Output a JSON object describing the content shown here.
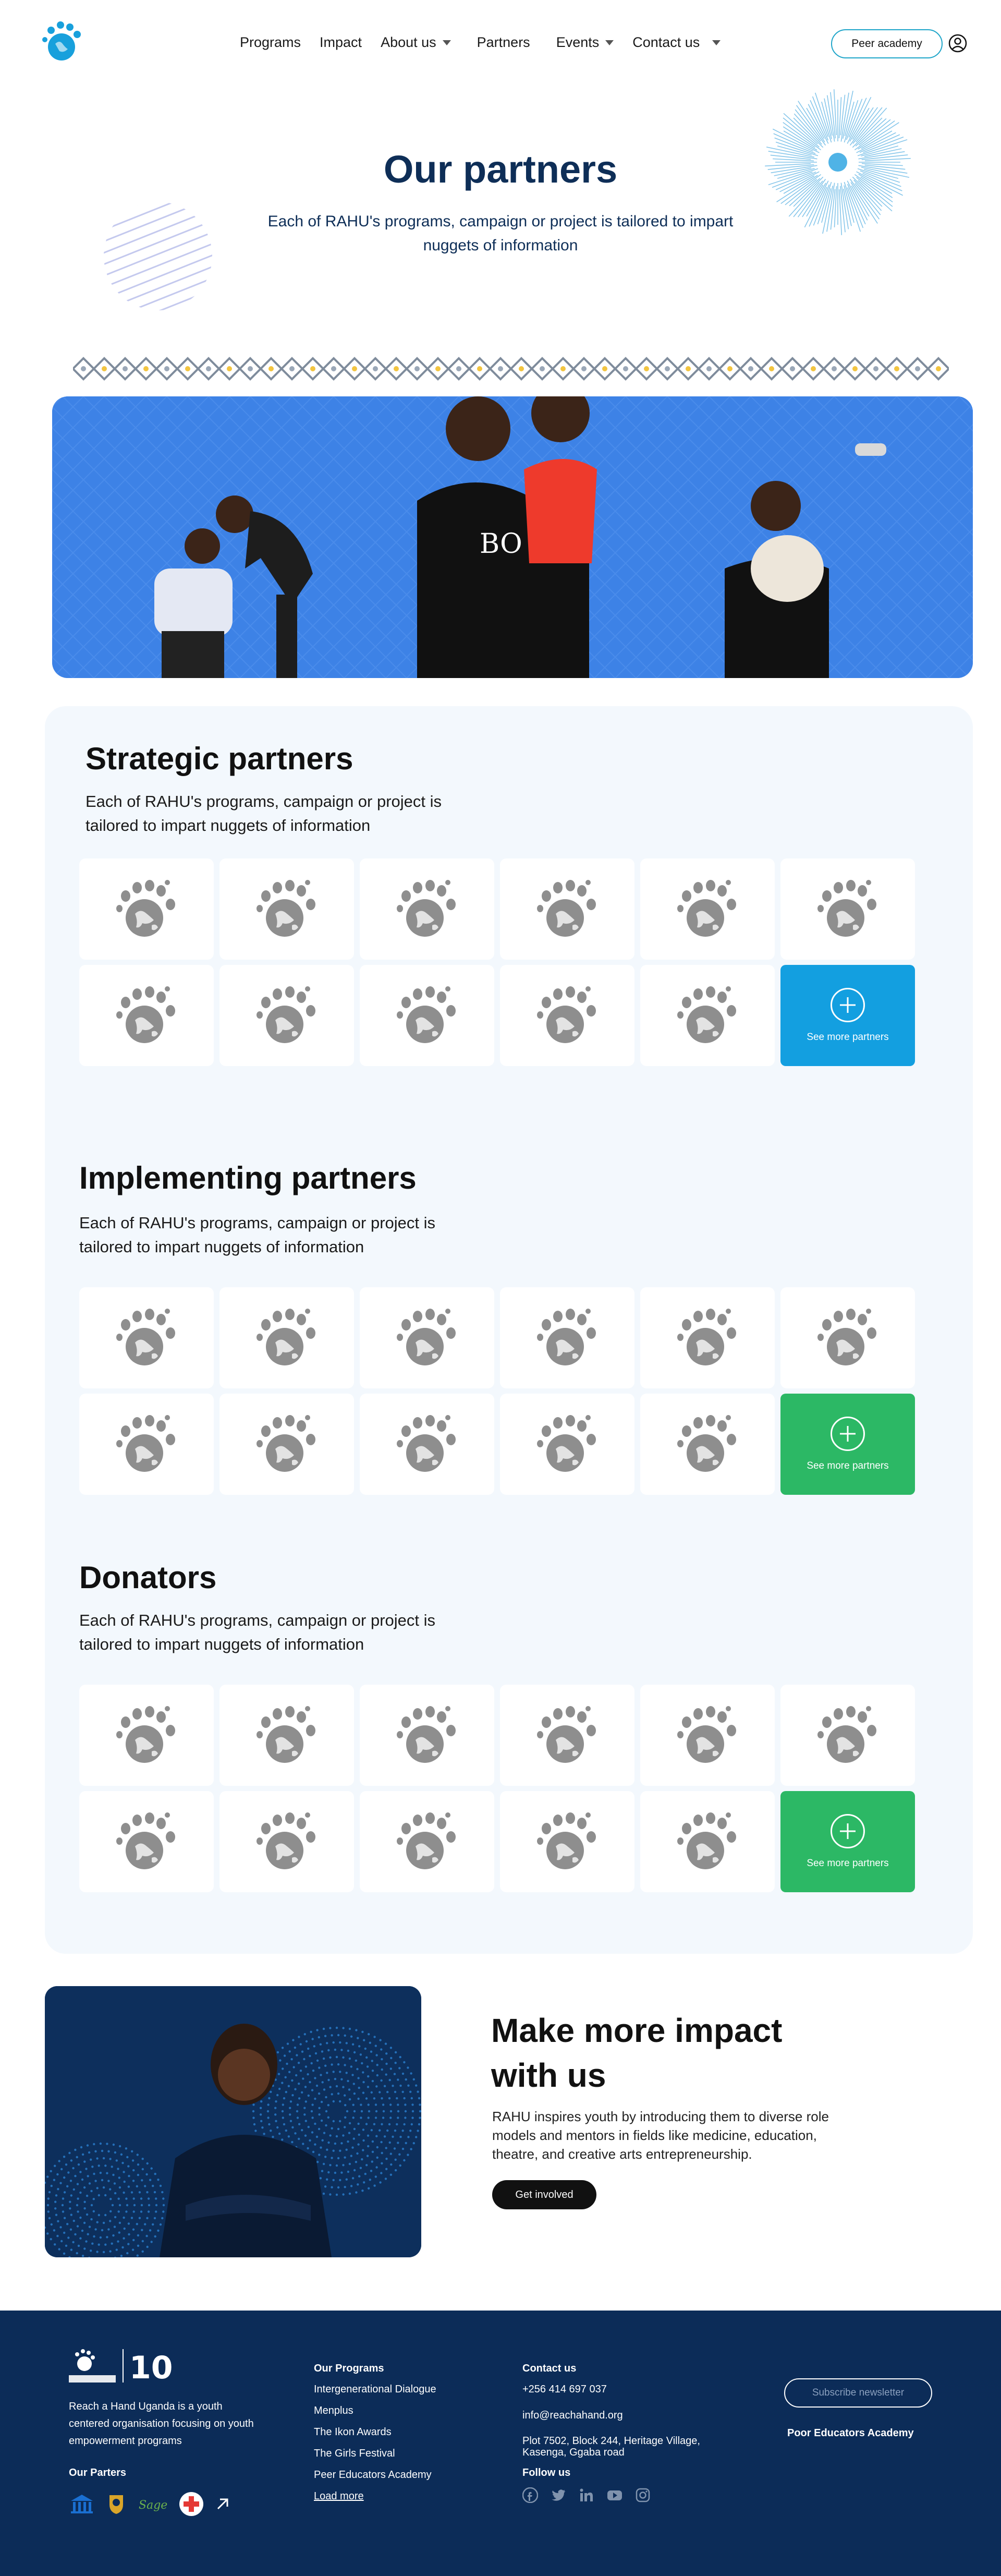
{
  "nav": {
    "items": [
      {
        "label": "Programs",
        "caret": false
      },
      {
        "label": "Impact",
        "caret": false
      },
      {
        "label": "About us",
        "caret": true
      },
      {
        "label": "Partners",
        "caret": false
      },
      {
        "label": "Events",
        "caret": true
      },
      {
        "label": "Contact us",
        "caret": true
      }
    ],
    "peer_academy": "Peer academy"
  },
  "hero": {
    "title": "Our partners",
    "subtitle": "Each of RAHU's programs, campaign or project is tailored to impart nuggets of information"
  },
  "sections": [
    {
      "title": "Strategic partners",
      "desc": "Each of RAHU's programs, campaign or project is tailored to impart nuggets of information",
      "more": "See more partners",
      "color": "#139fe0"
    },
    {
      "title": "Implementing partners",
      "desc": "Each of RAHU's programs, campaign or project is tailored to impart nuggets of information",
      "more": "See more partners",
      "color": "#2cb865"
    },
    {
      "title": "Donators",
      "desc": "Each of RAHU's programs, campaign or project is tailored to impart nuggets of information",
      "more": "See more partners",
      "color": "#2cb865"
    }
  ],
  "impact": {
    "title": "Make more impact with us",
    "text": "RAHU inspires youth by introducing them to diverse role models and mentors in fields like medicine, education, theatre, and creative arts entrepreneurship.",
    "button": "Get involved"
  },
  "footer": {
    "description": "Reach a Hand Uganda is a youth centered organisation focusing on youth empowerment programs",
    "partners_heading": "Our Parters",
    "programs_heading": "Our Programs",
    "programs": [
      "Intergenerational Dialogue",
      "Menplus",
      "The Ikon Awards",
      "The Girls Festival",
      "Peer Educators Academy"
    ],
    "load_more": "Load more",
    "contact_heading": "Contact us",
    "phone": "+256 414 697 037",
    "email": "info@reachahand.org",
    "address": "Plot 7502, Block 244, Heritage Village, Kasenga, Ggaba road",
    "follow_heading": "Follow us",
    "subscribe": "Subscribe newsletter",
    "academy": "Poor Educators Academy"
  },
  "colors": {
    "navy": "#0e2e57",
    "accent_blue": "#139fe0",
    "accent_green": "#2cb865",
    "banner": "#3d82e6",
    "footer": "#0c2c58"
  }
}
